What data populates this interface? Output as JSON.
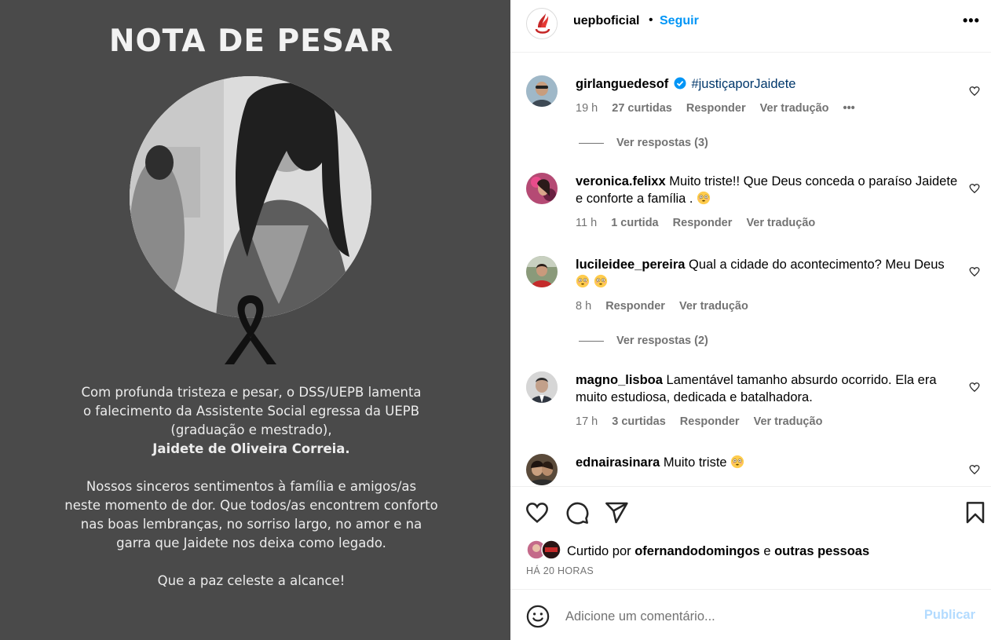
{
  "post_image": {
    "title": "NOTA DE PESAR",
    "para1_line1": "Com profunda tristeza e pesar, o DSS/UEPB lamenta",
    "para1_line2": "o falecimento da Assistente Social egressa da UEPB",
    "para1_line3": "(graduação e mestrado),",
    "para1_name": "Jaidete de Oliveira Correia.",
    "para2_line1": "Nossos sinceros sentimentos à família e amigos/as",
    "para2_line2": "neste momento de dor. Que todos/as encontrem conforto",
    "para2_line3": "nas boas lembranças, no sorriso largo, no amor e na",
    "para2_line4": "garra que Jaidete nos deixa como legado.",
    "para3": "Que a paz celeste a alcance!"
  },
  "header": {
    "username": "uepboficial",
    "separator": "•",
    "follow_label": "Seguir",
    "more_label": "•••"
  },
  "comments": [
    {
      "username": "girlanguedesof",
      "verified": true,
      "text": "#justiçaporJaidete",
      "time": "19 h",
      "likes": "27 curtidas",
      "reply": "Responder",
      "translate": "Ver tradução",
      "more": "•••",
      "view_replies": "Ver respostas (3)"
    },
    {
      "username": "veronica.felixx",
      "text": "Muito triste!! Que Deus conceda o paraíso Jaidete e conforte a família .",
      "time": "11 h",
      "likes": "1 curtida",
      "reply": "Responder",
      "translate": "Ver tradução"
    },
    {
      "username": "lucileidee_pereira",
      "text": "Qual a cidade do acontecimento? Meu Deus",
      "time": "8 h",
      "reply": "Responder",
      "translate": "Ver tradução",
      "view_replies": "Ver respostas (2)"
    },
    {
      "username": "magno_lisboa",
      "text": "Lamentável tamanho absurdo ocorrido. Ela era muito estudiosa, dedicada e batalhadora.",
      "time": "17 h",
      "likes": "3 curtidas",
      "reply": "Responder",
      "translate": "Ver tradução"
    },
    {
      "username": "ednairasinara",
      "text": "Muito triste"
    }
  ],
  "actions": {
    "liked_prefix": "Curtido por",
    "liked_user": "ofernandodomingos",
    "liked_and": "e",
    "liked_others": "outras pessoas",
    "time_ago": "HÁ 20 HORAS"
  },
  "add_comment": {
    "placeholder": "Adicione um comentário...",
    "publish_label": "Publicar"
  },
  "colors": {
    "accent": "#0095f6",
    "publish_disabled": "#b3dbff",
    "muted": "#737373",
    "image_bg": "#4a4a4a"
  },
  "icons": [
    "heart-icon",
    "comment-icon",
    "share-icon",
    "bookmark-icon",
    "smile-icon",
    "verified-icon",
    "ribbon-icon",
    "flushed-emoji-icon"
  ]
}
